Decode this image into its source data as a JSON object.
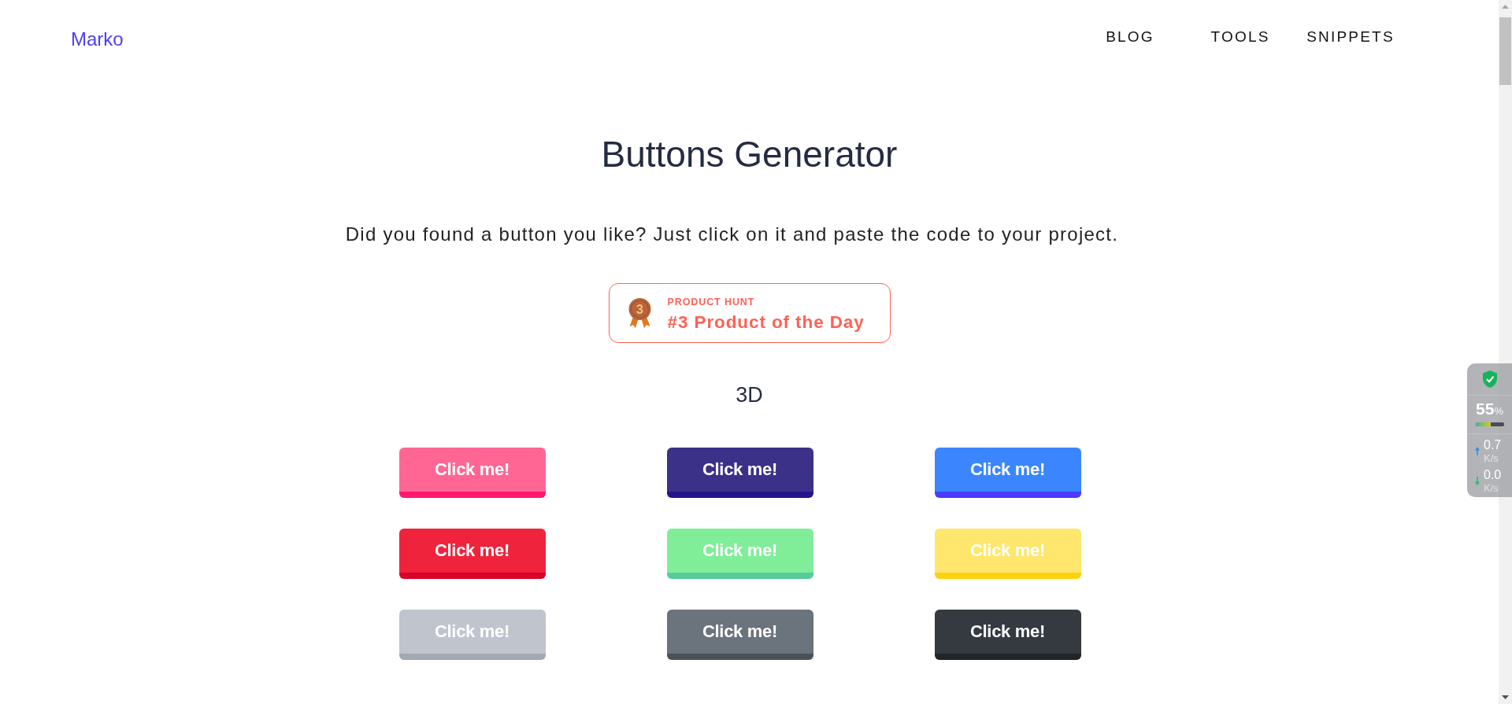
{
  "header": {
    "logo": "Marko",
    "nav": [
      {
        "label": "BLOG"
      },
      {
        "label": "TOOLS"
      },
      {
        "label": "SNIPPETS"
      }
    ]
  },
  "hero": {
    "title": "Buttons Generator",
    "description": "Did you found a button you like? Just click on it and paste the code to your project."
  },
  "badge": {
    "rank": "3",
    "eyebrow": "PRODUCT HUNT",
    "title": "#3 Product of the Day"
  },
  "sections": [
    {
      "title": "3D",
      "buttons": [
        {
          "label": "Click me!",
          "color": "#ff6694",
          "edge": {
            "color": "#ff1870"
          }
        },
        {
          "label": "Click me!",
          "color": "#3c3189",
          "edge": {
            "color": "#26148a"
          }
        },
        {
          "label": "Click me!",
          "color": "#3b86ff",
          "edge": {
            "color": "#4a3bff"
          }
        },
        {
          "label": "Click me!",
          "color": "#ef233c",
          "edge": {
            "color": "#d90429"
          }
        },
        {
          "label": "Click me!",
          "color": "#80ed99",
          "edge": {
            "color": "#57cc99"
          }
        },
        {
          "label": "Click me!",
          "color": "#ffe66d",
          "edge": {
            "color": "#fdd20e"
          }
        },
        {
          "label": "Click me!",
          "color": "#c0c5cd",
          "edge": {
            "color": "#a2a9b2"
          }
        },
        {
          "label": "Click me!",
          "color": "#6b737c",
          "edge": {
            "color": "#4b5158"
          }
        },
        {
          "label": "Click me!",
          "color": "#343a40",
          "edge": {
            "color": "#212529"
          }
        }
      ]
    }
  ],
  "system_monitor": {
    "usage": "55",
    "usage_unit": "%",
    "level": 0.55,
    "speeds": [
      {
        "kind": "upload",
        "value": "0.7",
        "unit": "K/s"
      },
      {
        "kind": "download",
        "value": "0.0",
        "unit": "K/s"
      }
    ]
  }
}
